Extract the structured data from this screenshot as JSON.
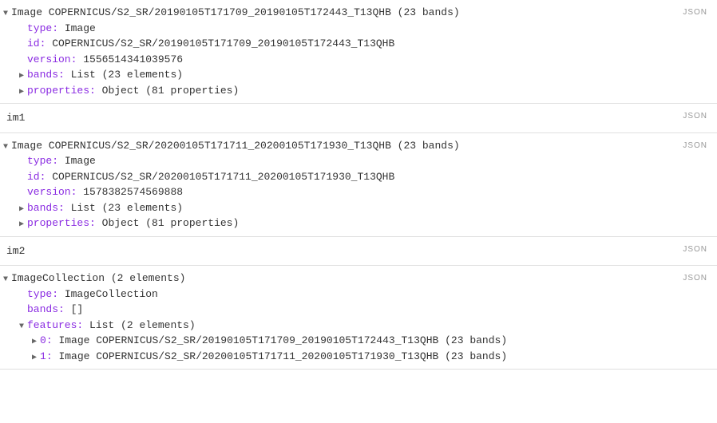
{
  "json_label": "JSON",
  "panels": [
    {
      "header": "Image COPERNICUS/S2_SR/20190105T171709_20190105T172443_T13QHB (23 bands)",
      "props": {
        "type": "Image",
        "id": "COPERNICUS/S2_SR/20190105T171709_20190105T172443_T13QHB",
        "version": "1556514341039576",
        "bands": "List (23 elements)",
        "properties": "Object (81 properties)"
      },
      "caption": "im1"
    },
    {
      "header": "Image COPERNICUS/S2_SR/20200105T171711_20200105T171930_T13QHB (23 bands)",
      "props": {
        "type": "Image",
        "id": "COPERNICUS/S2_SR/20200105T171711_20200105T171930_T13QHB",
        "version": "1578382574569888",
        "bands": "List (23 elements)",
        "properties": "Object (81 properties)"
      },
      "caption": "im2"
    }
  ],
  "collection": {
    "header": "ImageCollection (2 elements)",
    "type": "ImageCollection",
    "bands": "[]",
    "features_label": "List (2 elements)",
    "features": [
      {
        "idx": "0",
        "val": "Image COPERNICUS/S2_SR/20190105T171709_20190105T172443_T13QHB (23 bands)"
      },
      {
        "idx": "1",
        "val": "Image COPERNICUS/S2_SR/20200105T171711_20200105T171930_T13QHB (23 bands)"
      }
    ]
  }
}
